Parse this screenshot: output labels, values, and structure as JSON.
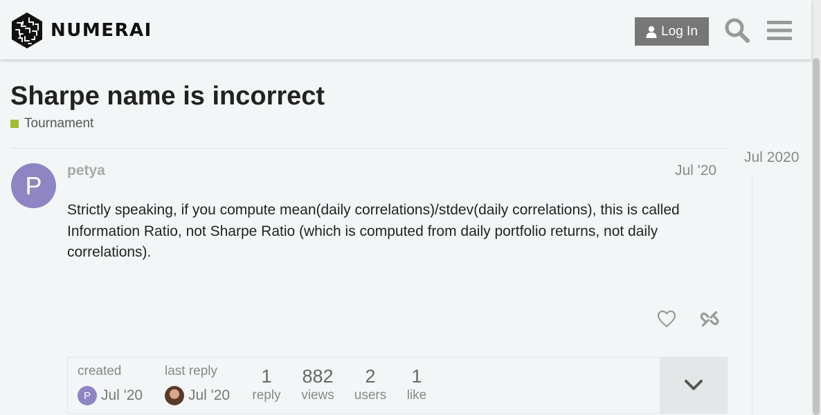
{
  "header": {
    "logo_text": "NUMERAI",
    "login_label": "Log In",
    "search_icon": "search-icon",
    "menu_icon": "hamburger-menu-icon"
  },
  "topic": {
    "title": "Sharpe name is incorrect",
    "category": "Tournament",
    "category_color": "#9fbe33"
  },
  "post": {
    "avatar_letter": "P",
    "avatar_color": "#8e85c2",
    "username": "petya",
    "date": "Jul '20",
    "body": "Strictly speaking, if you compute mean(daily correlations)/stdev(daily correlations), this is called Information Ratio, not Sharpe Ratio (which is computed from daily portfolio returns, not daily correlations).",
    "actions": [
      "heart-icon",
      "link-icon"
    ]
  },
  "timeline": {
    "date": "Jul 2020"
  },
  "topic_map": {
    "created_label": "created",
    "created_avatar": "P",
    "created_date": "Jul '20",
    "last_reply_label": "last reply",
    "last_reply_date": "Jul '20",
    "replies_count": "1",
    "replies_label": "reply",
    "views_count": "882",
    "views_label": "views",
    "users_count": "2",
    "users_label": "users",
    "likes_count": "1",
    "likes_label": "like"
  }
}
